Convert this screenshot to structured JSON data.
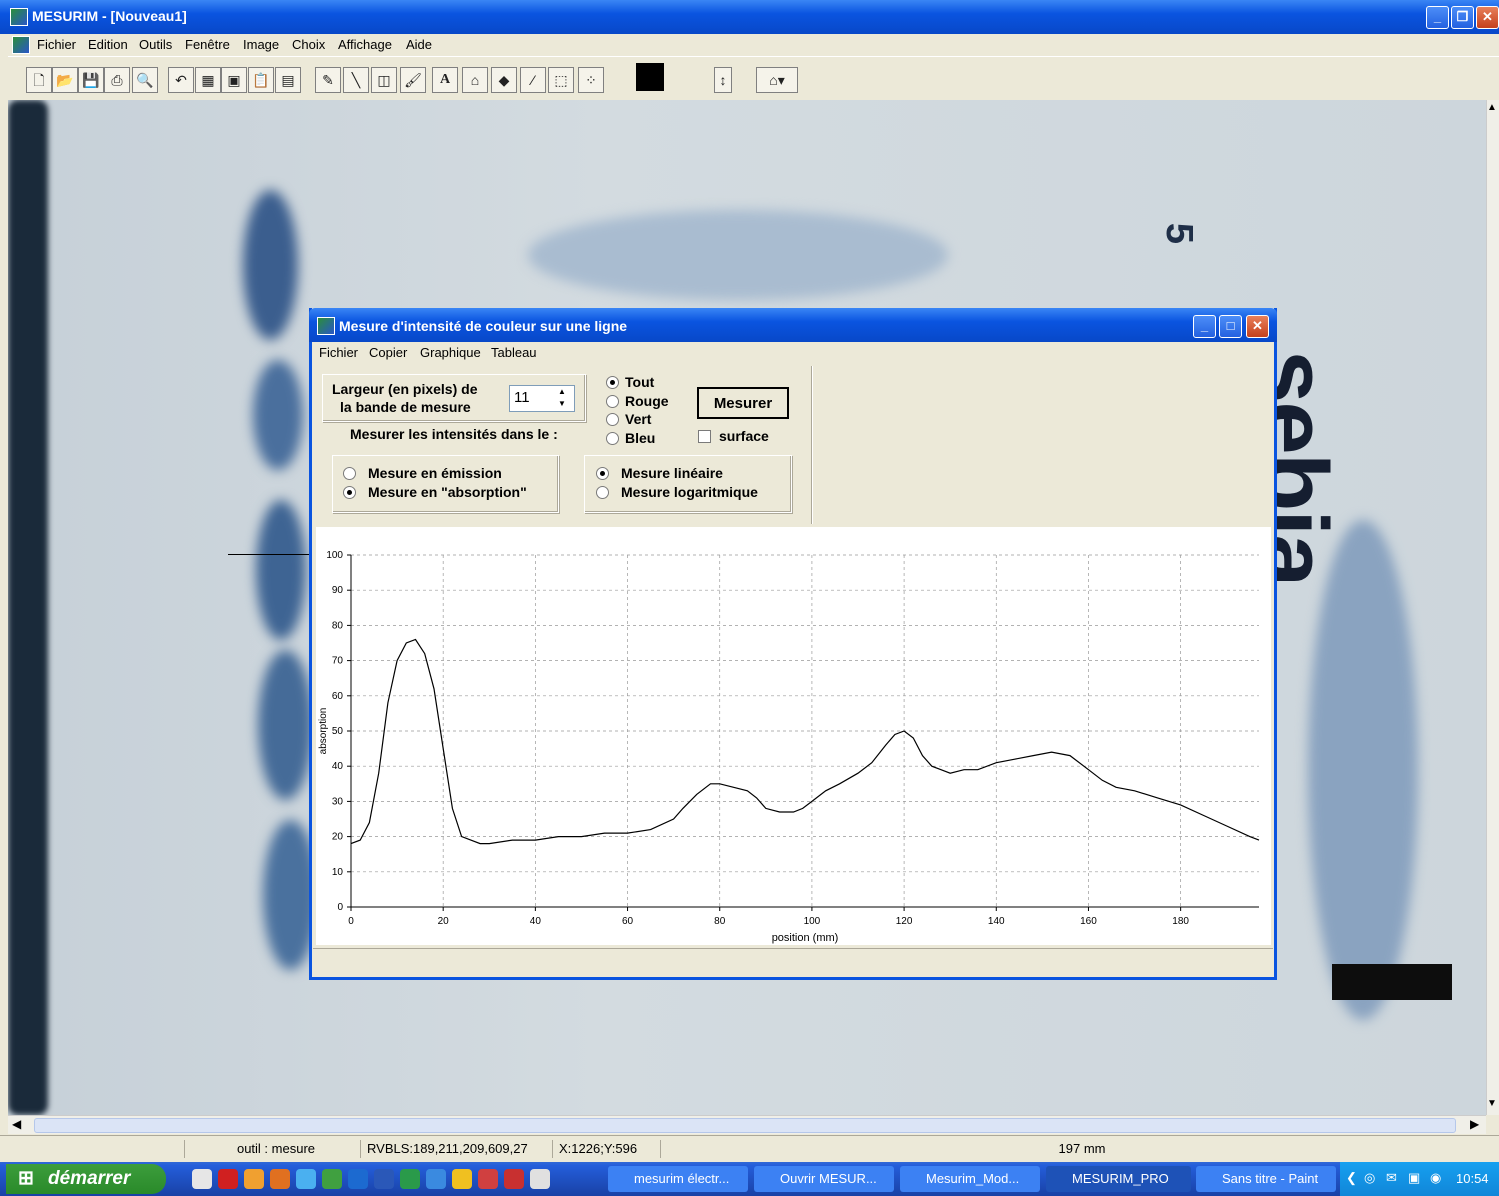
{
  "app": {
    "title": "MESURIM - [Nouveau1]"
  },
  "menubar": [
    "Fichier",
    "Edition",
    "Outils",
    "Fenêtre",
    "Image",
    "Choix",
    "Affichage",
    "Aide"
  ],
  "canvas_text": {
    "digit": "5",
    "brand": "sebia"
  },
  "statusbar": {
    "tool": "outil : mesure",
    "rgb": "RVBLS:189,211,209,609,27",
    "coords": "X:1226;Y:596",
    "length": "197 mm"
  },
  "dialog": {
    "title": "Mesure d'intensité de couleur sur une ligne",
    "menu": [
      "Fichier",
      "Copier",
      "Graphique",
      "Tableau"
    ],
    "width_label_1": "Largeur (en pixels) de",
    "width_label_2": "la bande de mesure",
    "width_value": "11",
    "channels": [
      "Tout",
      "Rouge",
      "Vert",
      "Bleu"
    ],
    "channel_selected": "Tout",
    "measure_button": "Mesurer",
    "intensity_label": "Mesurer les intensités dans le :",
    "surface_label": "surface",
    "surface_checked": false,
    "mode_options": [
      "Mesure en émission",
      "Mesure en \"absorption\""
    ],
    "mode_selected": "Mesure en \"absorption\"",
    "scale_options": [
      "Mesure linéaire",
      "Mesure logaritmique"
    ],
    "scale_selected": "Mesure linéaire"
  },
  "chart_data": {
    "type": "line",
    "xlabel": "position (mm)",
    "ylabel": "absorption",
    "xlim": [
      0,
      197
    ],
    "ylim": [
      0,
      100
    ],
    "xticks": [
      0,
      20,
      40,
      60,
      80,
      100,
      120,
      140,
      160,
      180
    ],
    "yticks": [
      0,
      10,
      20,
      30,
      40,
      50,
      60,
      70,
      80,
      90,
      100
    ],
    "grid": true,
    "series": [
      {
        "x": [
          0,
          2,
          4,
          6,
          8,
          10,
          12,
          14,
          16,
          18,
          20,
          22,
          24,
          26,
          28,
          30,
          35,
          40,
          45,
          50,
          55,
          60,
          65,
          70,
          72,
          75,
          78,
          80,
          83,
          86,
          88,
          90,
          93,
          96,
          98,
          100,
          103,
          106,
          110,
          113,
          116,
          118,
          120,
          122,
          124,
          126,
          128,
          130,
          133,
          136,
          140,
          144,
          148,
          152,
          156,
          160,
          163,
          166,
          170,
          175,
          180,
          185,
          190,
          195,
          197
        ],
        "y": [
          18,
          19,
          24,
          38,
          58,
          70,
          75,
          76,
          72,
          62,
          45,
          28,
          20,
          19,
          18,
          18,
          19,
          19,
          20,
          20,
          21,
          21,
          22,
          25,
          28,
          32,
          35,
          35,
          34,
          33,
          31,
          28,
          27,
          27,
          28,
          30,
          33,
          35,
          38,
          41,
          46,
          49,
          50,
          48,
          43,
          40,
          39,
          38,
          39,
          39,
          41,
          42,
          43,
          44,
          43,
          39,
          36,
          34,
          33,
          31,
          29,
          26,
          23,
          20,
          19
        ]
      }
    ]
  },
  "taskbar": {
    "start": "démarrer",
    "tasks": [
      "mesurim électr...",
      "Ouvrir MESUR...",
      "Mesurim_Mod...",
      "MESURIM_PRO",
      "Sans titre - Paint"
    ],
    "active_task": "MESURIM_PRO",
    "clock": "10:54"
  }
}
